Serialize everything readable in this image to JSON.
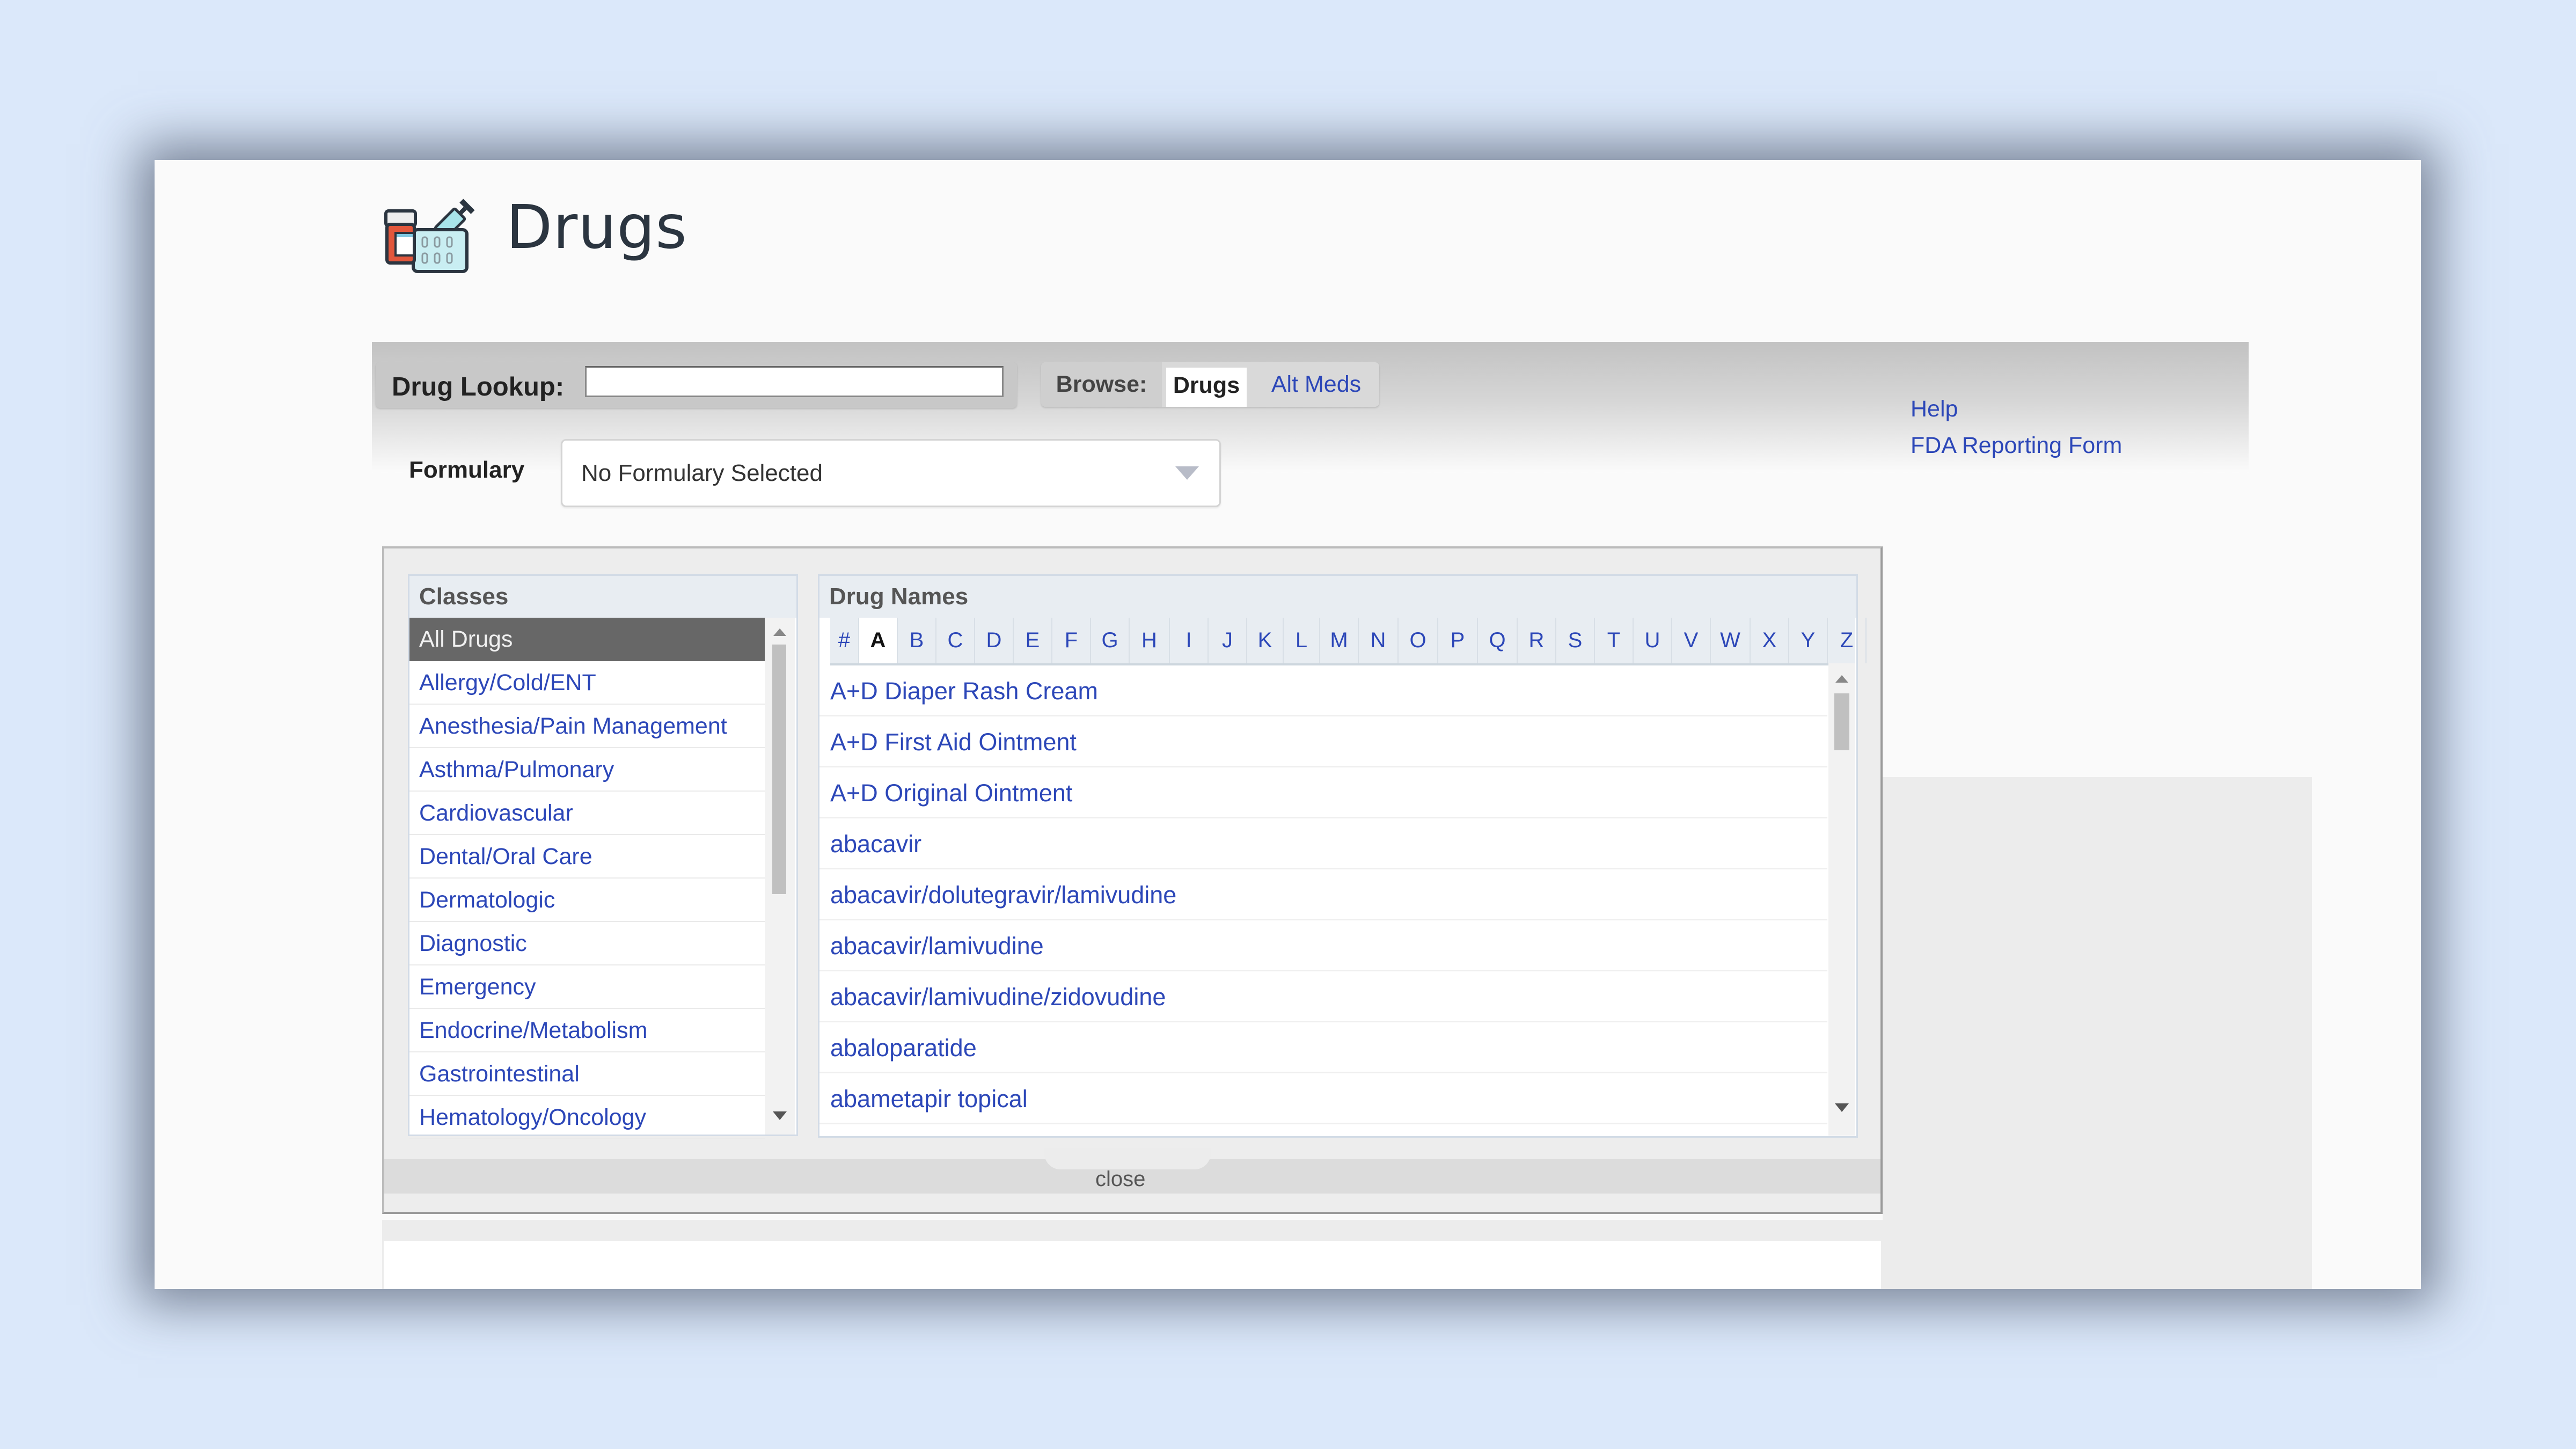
{
  "page": {
    "title": "Drugs",
    "icon": "drugs-icon"
  },
  "lookup": {
    "label": "Drug Lookup:",
    "value": "",
    "placeholder": ""
  },
  "browse": {
    "label": "Browse:",
    "tabs": [
      {
        "label": "Drugs",
        "active": true
      },
      {
        "label": "Alt Meds",
        "active": false
      }
    ]
  },
  "links": {
    "help": "Help",
    "fda": "FDA Reporting Form"
  },
  "formulary": {
    "label": "Formulary",
    "selected": "No Formulary Selected"
  },
  "classes": {
    "header": "Classes",
    "items": [
      "All Drugs",
      "Allergy/Cold/ENT",
      "Anesthesia/Pain Management",
      "Asthma/Pulmonary",
      "Cardiovascular",
      "Dental/Oral Care",
      "Dermatologic",
      "Diagnostic",
      "Emergency",
      "Endocrine/Metabolism",
      "Gastrointestinal",
      "Hematology/Oncology"
    ],
    "selected": "All Drugs"
  },
  "drug_names": {
    "header": "Drug Names",
    "letters": [
      "#",
      "A",
      "B",
      "C",
      "D",
      "E",
      "F",
      "G",
      "H",
      "I",
      "J",
      "K",
      "L",
      "M",
      "N",
      "O",
      "P",
      "Q",
      "R",
      "S",
      "T",
      "U",
      "V",
      "W",
      "X",
      "Y",
      "Z"
    ],
    "active_letter": "A",
    "items": [
      "A+D Diaper Rash Cream",
      "A+D First Aid Ointment",
      "A+D Original Ointment",
      "abacavir",
      "abacavir/dolutegravir/lamivudine",
      "abacavir/lamivudine",
      "abacavir/lamivudine/zidovudine",
      "abaloparatide",
      "abametapir topical"
    ]
  },
  "panel": {
    "close_label": "close"
  },
  "colors": {
    "link": "#2c47b8",
    "selected_class_bg": "#676767",
    "background": "#dbe8fa"
  }
}
